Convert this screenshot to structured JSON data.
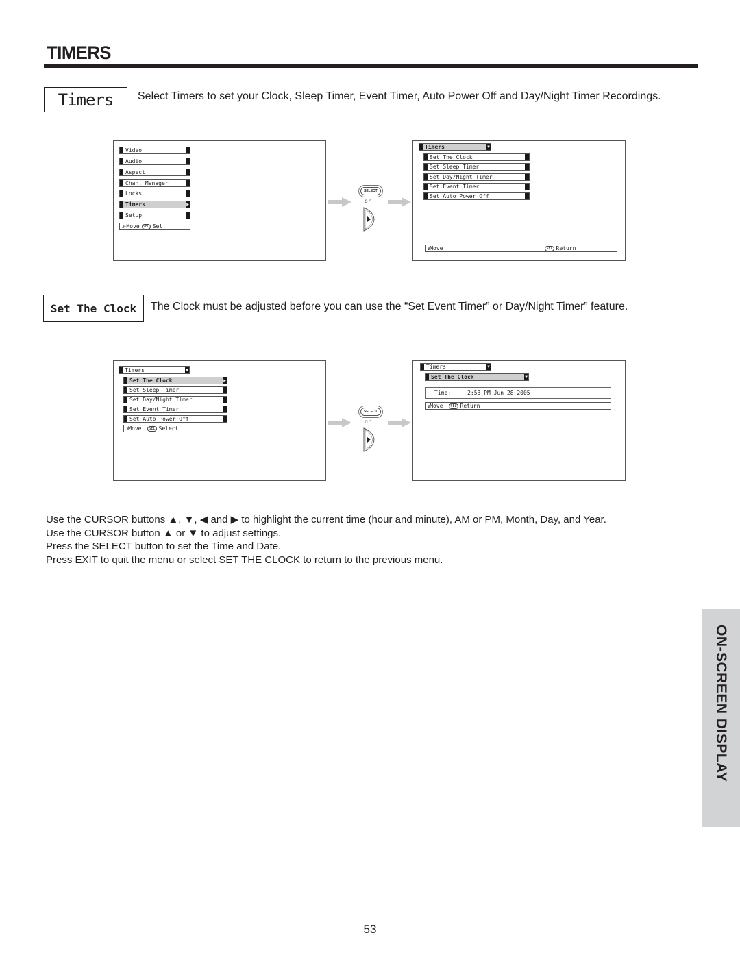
{
  "page": {
    "section_title": "TIMERS",
    "side_tab": "ON-SCREEN DISPLAY",
    "page_number": "53"
  },
  "intro": {
    "tag": "Timers",
    "text": "Select Timers to set your Clock, Sleep Timer, Event Timer, Auto Power Off and Day/Night Timer Recordings."
  },
  "clock_section": {
    "tag": "Set The Clock",
    "text": "The Clock must be adjusted before you can use the “Set Event Timer” or Day/Night Timer” feature."
  },
  "transition": {
    "select_label": "SELECT",
    "or_label": "or",
    "right_arrow_icon": "cursor-right-button"
  },
  "screen_main_menu": {
    "items": [
      "Video",
      "Audio",
      "Aspect",
      "Chan. Manager",
      "Locks",
      "Timers",
      "Setup"
    ],
    "highlighted": "Timers",
    "nav": {
      "move": "Move",
      "sel_icon": "SEL",
      "action": "Sel"
    }
  },
  "screen_timers_menu": {
    "header": "Timers",
    "items": [
      "Set The Clock",
      "Set Sleep Timer",
      "Set Day/Night Timer",
      "Set Event Timer",
      "Set Auto Power Off"
    ],
    "nav": {
      "move": "Move",
      "sel_icon": "SEL",
      "action": "Return"
    }
  },
  "screen_timers_clock_selected": {
    "header": "Timers",
    "items": [
      "Set The Clock",
      "Set Sleep Timer",
      "Set Day/Night Timer",
      "Set Event Timer",
      "Set Auto Power Off"
    ],
    "highlighted": "Set The Clock",
    "nav": {
      "move": "Move",
      "sel_icon": "SEL",
      "action": "Select"
    }
  },
  "screen_set_clock": {
    "header": "Timers",
    "subheader": "Set The Clock",
    "time_label": "Time:",
    "time_value": "2:53 PM Jun 28 2005",
    "nav": {
      "move": "Move",
      "sel_icon": "SEL",
      "action": "Return"
    }
  },
  "instructions": [
    "Use the CURSOR buttons ▲, ▼, ◀ and ▶ to highlight the current time (hour and minute), AM or PM, Month, Day, and Year.",
    "Use the CURSOR button ▲ or ▼ to adjust settings.",
    "Press the SELECT button to set the Time and Date.",
    "Press EXIT to quit the menu or select SET THE CLOCK to return to the previous menu."
  ]
}
